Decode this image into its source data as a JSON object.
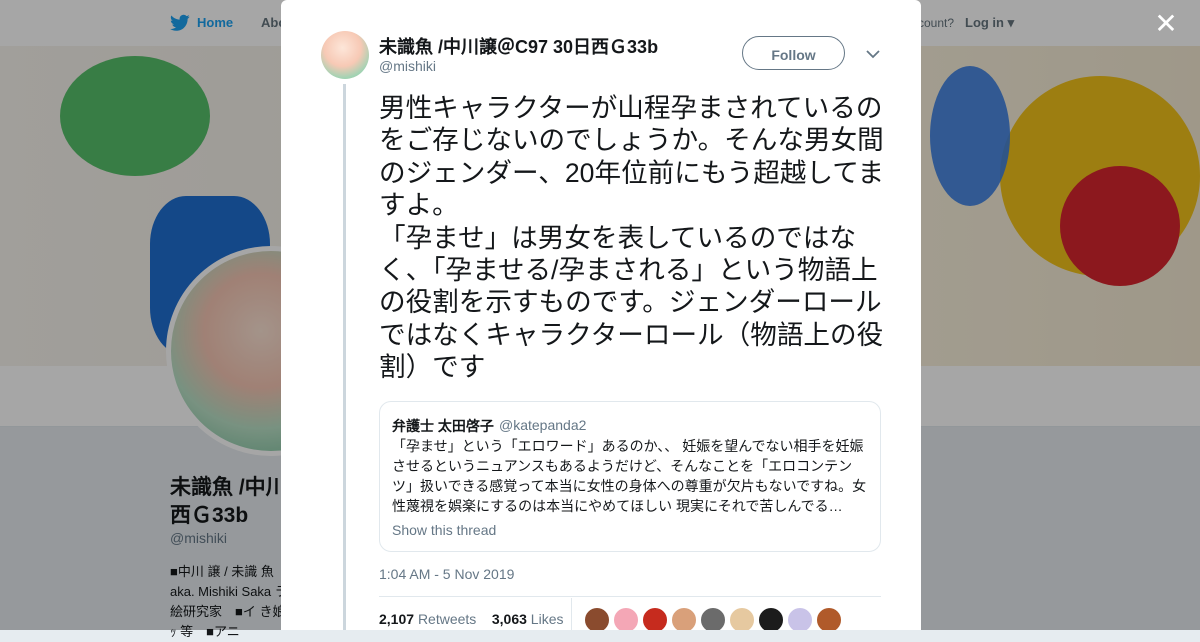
{
  "topbar": {
    "home_label": "Home",
    "about_label": "Abo",
    "have_account_label": "ccount?",
    "login_label": "Log in"
  },
  "background_profile": {
    "name": "未識魚 /中川\n西Ｇ33b",
    "handle": "@mishiki",
    "bio": "■中川 譲 / 未識 魚 aka. Mishiki Saka ラ絵研究家　■イ き娘ｯ 等　■アニ"
  },
  "tweet": {
    "author_name": "未識魚 /中川譲＠C97 30日西Ｇ33b",
    "author_handle": "@mishiki",
    "follow_label": "Follow",
    "text": "男性キャラクターが山程孕まされているのをご存じないのでしょうか。そんな男女間のジェンダー、20年位前にもう超越してますよ。\n「孕ませ」は男女を表しているのではなく、「孕ませる/孕まされる」という物語上の役割を示すものです。ジェンダーロールではなくキャラクターロール（物語上の役割）です",
    "quote": {
      "author_name": "弁護士 太田啓子",
      "author_handle": "@katepanda2",
      "text": "「孕ませ」という「エロワード」あるのか、、 妊娠を望んでない相手を妊娠させるというニュアンスもあるようだけど、そんなことを「エロコンテンツ」扱いできる感覚って本当に女性の身体への尊重が欠片もないですね。女性蔑視を娯楽にするのは本当にやめてほしい 現実にそれで苦しんでる…",
      "show_thread_label": "Show this thread"
    },
    "timestamp": "1:04 AM - 5 Nov 2019",
    "retweets_count": "2,107",
    "retweets_label": "Retweets",
    "likes_count": "3,063",
    "likes_label": "Likes"
  },
  "colors": {
    "accent": "#1da1f2",
    "secondary_text": "#657786",
    "primary_text": "#14171a"
  },
  "icons": {
    "logo": "twitter-bird-icon",
    "close": "close-icon",
    "caret": "chevron-down-icon"
  }
}
